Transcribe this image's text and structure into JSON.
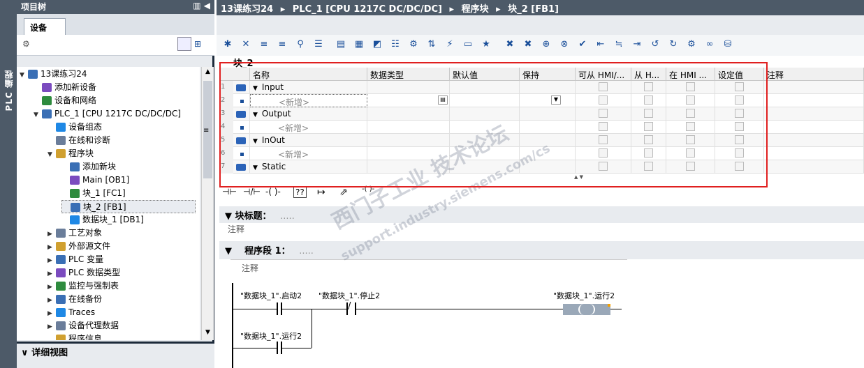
{
  "left_strip": {
    "label": "PLC 编程"
  },
  "project_tree": {
    "title": "项目树",
    "tab": "设备",
    "items": [
      {
        "label": "13课练习24",
        "level": 0,
        "expanded": true
      },
      {
        "label": "添加新设备",
        "level": 1
      },
      {
        "label": "设备和网络",
        "level": 1
      },
      {
        "label": "PLC_1 [CPU 1217C DC/DC/DC]",
        "level": 1,
        "expanded": true
      },
      {
        "label": "设备组态",
        "level": 2
      },
      {
        "label": "在线和诊断",
        "level": 2
      },
      {
        "label": "程序块",
        "level": 2,
        "expanded": true
      },
      {
        "label": "添加新块",
        "level": 3
      },
      {
        "label": "Main [OB1]",
        "level": 3
      },
      {
        "label": "块_1 [FC1]",
        "level": 3
      },
      {
        "label": "块_2 [FB1]",
        "level": 3,
        "selected": true
      },
      {
        "label": "数据块_1 [DB1]",
        "level": 3
      },
      {
        "label": "工艺对象",
        "level": 2
      },
      {
        "label": "外部源文件",
        "level": 2
      },
      {
        "label": "PLC 变量",
        "level": 2
      },
      {
        "label": "PLC 数据类型",
        "level": 2
      },
      {
        "label": "监控与强制表",
        "level": 2
      },
      {
        "label": "在线备份",
        "level": 2
      },
      {
        "label": "Traces",
        "level": 2
      },
      {
        "label": "设备代理数据",
        "level": 2
      },
      {
        "label": "程序信息",
        "level": 2
      }
    ],
    "detail_view": "详细视图"
  },
  "breadcrumb": [
    "13课练习24",
    "PLC_1 [CPU 1217C DC/DC/DC]",
    "程序块",
    "块_2 [FB1]"
  ],
  "block_name": "块_2",
  "interface_table": {
    "columns": [
      "名称",
      "数据类型",
      "默认值",
      "保持",
      "可从 HMI/...",
      "从 H...",
      "在 HMI ...",
      "设定值",
      "注释"
    ],
    "rows": [
      {
        "num": "1",
        "name": "Input",
        "kind": "section"
      },
      {
        "num": "2",
        "name": "<新增>",
        "kind": "add"
      },
      {
        "num": "3",
        "name": "Output",
        "kind": "section"
      },
      {
        "num": "4",
        "name": "<新增>",
        "kind": "add"
      },
      {
        "num": "5",
        "name": "InOut",
        "kind": "section"
      },
      {
        "num": "6",
        "name": "<新增>",
        "kind": "add"
      },
      {
        "num": "7",
        "name": "Static",
        "kind": "section"
      }
    ]
  },
  "block_title": {
    "label": "块标题：",
    "placeholder": ".....",
    "comment": "注释"
  },
  "network": {
    "label": "程序段 1：",
    "placeholder": ".....",
    "comment": "注释"
  },
  "ladder": {
    "contact1": "\"数据块_1\".启动2",
    "contact2": "\"数据块_1\".停止2",
    "coil": "\"数据块_1\".运行2",
    "contact3": "\"数据块_1\".运行2"
  },
  "watermark": {
    "cn": "西门子工业 技术论坛",
    "url": "support.industry.siemens.com/cs"
  },
  "colors": {
    "header_bg": "#4d5a68",
    "red_box": "#e02020",
    "accent_blue": "#1a4f9a"
  }
}
